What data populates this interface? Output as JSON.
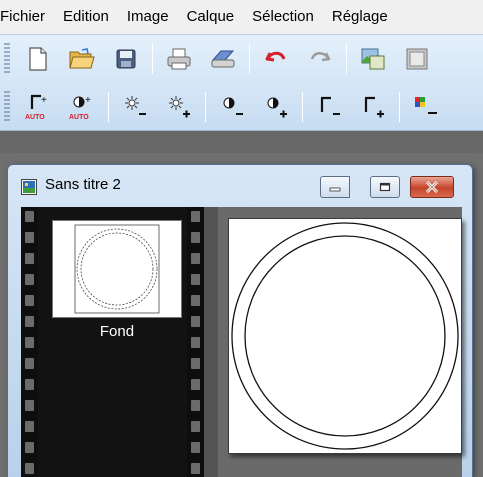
{
  "menu": {
    "items": [
      "Fichier",
      "Edition",
      "Image",
      "Calque",
      "Sélection",
      "Réglage"
    ]
  },
  "toolbar1": {
    "icons": [
      "new-document-icon",
      "open-folder-icon",
      "save-disk-icon",
      "print-icon",
      "scan-icon",
      "undo-icon",
      "redo-icon",
      "import-image-icon",
      "export-image-icon"
    ]
  },
  "toolbar2": {
    "icons": [
      "gamma-auto-icon",
      "contrast-auto-icon",
      "brightness-decrease-icon",
      "brightness-increase-icon",
      "contrast-decrease-icon",
      "contrast-increase-icon",
      "gamma-decrease-icon",
      "gamma-increase-icon",
      "color-balance-icon"
    ],
    "auto_label": "AUTO"
  },
  "window": {
    "title": "Sans titre 2"
  },
  "layers": {
    "items": [
      {
        "name": "Fond"
      }
    ]
  },
  "colors": {
    "toolbar_bg": "#c7dcf2",
    "workspace": "#6a6a6a",
    "film": "#121212",
    "close_button": "#c6452a",
    "undo_red": "#d6202a"
  }
}
